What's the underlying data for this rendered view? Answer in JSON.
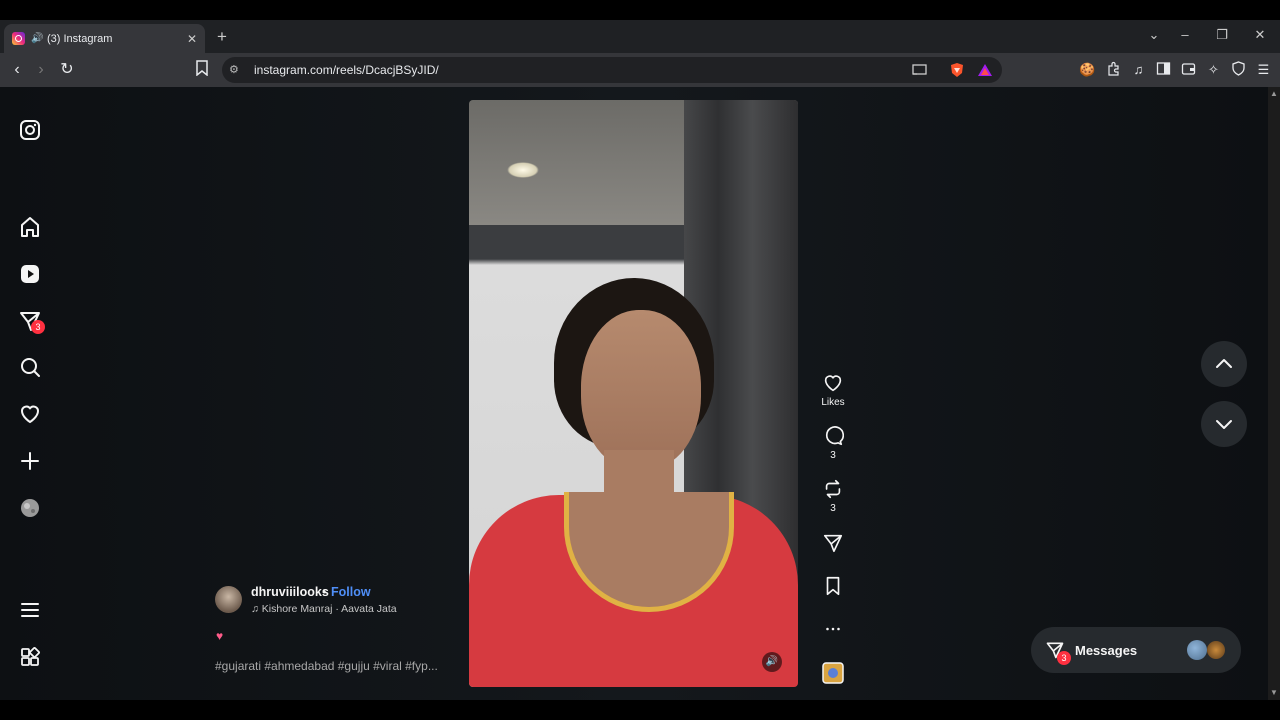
{
  "browser": {
    "tab_title": "(3) Instagram",
    "url": "instagram.com/reels/DcacjBSyJID/"
  },
  "sidebar": {
    "notifications_badge": "3"
  },
  "reel": {
    "author": "dhruviiilooks",
    "separator": "•",
    "follow_label": "Follow",
    "audio": "Kishore Manraj · Aavata Jata",
    "emoji": "♥",
    "caption": "#gujarati #ahmedabad #gujju #viral #fyp...",
    "likes_label": "Likes",
    "comments_count": "3",
    "reposts_count": "3"
  },
  "messages": {
    "label": "Messages",
    "badge": "3"
  },
  "colors": {
    "accent_link": "#4f8ef7",
    "badge": "#ff3040",
    "page_bg": "#121518"
  }
}
